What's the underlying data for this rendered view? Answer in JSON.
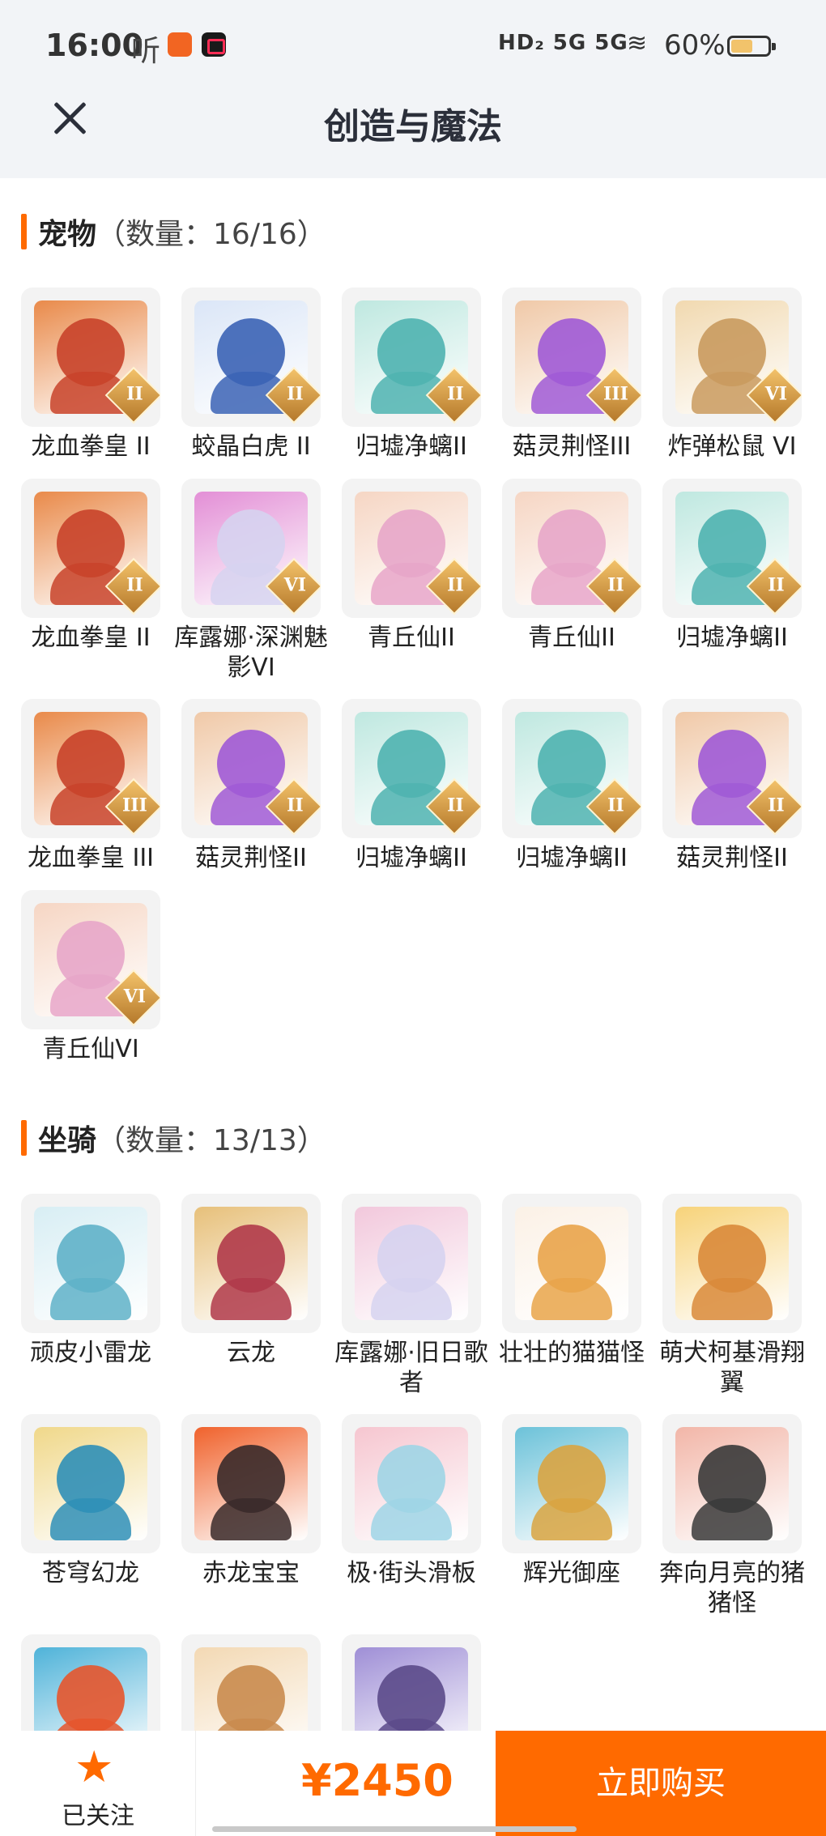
{
  "status_bar": {
    "time": "16:00",
    "listen": "听",
    "network": "HD₂ 5G 5G",
    "battery_text": "60%",
    "battery_level": 0.6
  },
  "header": {
    "title": "创造与魔法",
    "close_icon": "close-icon"
  },
  "pets": {
    "name": "宠物",
    "count": "（数量：16/16）",
    "items": [
      {
        "label": "龙血拳皇 II",
        "badge": "II",
        "color": "#c8432a",
        "accent": "#e98a4a"
      },
      {
        "label": "蛟晶白虎 II",
        "badge": "II",
        "color": "#3b63b5",
        "accent": "#dbe6f7"
      },
      {
        "label": "归墟净螭II",
        "badge": "II",
        "color": "#4fb3b0",
        "accent": "#bfe8e0"
      },
      {
        "label": "菇灵荆怪III",
        "badge": "III",
        "color": "#a05ad6",
        "accent": "#f0c9a8"
      },
      {
        "label": "炸弹松鼠 VI",
        "badge": "VI",
        "color": "#c99a5e",
        "accent": "#f1d9b0"
      },
      {
        "label": "龙血拳皇 II",
        "badge": "II",
        "color": "#c8432a",
        "accent": "#e98a4a"
      },
      {
        "label": "库露娜·深渊魅影VI",
        "badge": "VI",
        "color": "#d6d3f0",
        "accent": "#e38fd6"
      },
      {
        "label": "青丘仙II",
        "badge": "II",
        "color": "#e7a6c9",
        "accent": "#f6d6c4"
      },
      {
        "label": "青丘仙II",
        "badge": "II",
        "color": "#e7a6c9",
        "accent": "#f6d6c4"
      },
      {
        "label": "归墟净螭II",
        "badge": "II",
        "color": "#4fb3b0",
        "accent": "#bfe8e0"
      },
      {
        "label": "龙血拳皇 III",
        "badge": "III",
        "color": "#c8432a",
        "accent": "#e98a4a"
      },
      {
        "label": "菇灵荆怪II",
        "badge": "II",
        "color": "#a05ad6",
        "accent": "#f0c9a8"
      },
      {
        "label": "归墟净螭II",
        "badge": "II",
        "color": "#4fb3b0",
        "accent": "#bfe8e0"
      },
      {
        "label": "归墟净螭II",
        "badge": "II",
        "color": "#4fb3b0",
        "accent": "#bfe8e0"
      },
      {
        "label": "菇灵荆怪II",
        "badge": "II",
        "color": "#a05ad6",
        "accent": "#f0c9a8"
      },
      {
        "label": "青丘仙VI",
        "badge": "VI",
        "color": "#e7a6c9",
        "accent": "#f6d6c4"
      }
    ]
  },
  "mounts": {
    "name": "坐骑",
    "count": "（数量：13/13）",
    "items": [
      {
        "label": "顽皮小雷龙",
        "color": "#5fb1c8",
        "accent": "#d8eef4"
      },
      {
        "label": "云龙",
        "color": "#b03a4a",
        "accent": "#e7c07a"
      },
      {
        "label": "库露娜·旧日歌者",
        "color": "#d6d3f0",
        "accent": "#f2c8dc"
      },
      {
        "label": "壮壮的猫猫怪",
        "color": "#e9a44a",
        "accent": "#fbf1e6"
      },
      {
        "label": "萌犬柯基滑翔翼",
        "color": "#d98a3a",
        "accent": "#f7d37a"
      },
      {
        "label": "苍穹幻龙",
        "color": "#2f8fb7",
        "accent": "#f0d88a"
      },
      {
        "label": "赤龙宝宝",
        "color": "#3a2a2a",
        "accent": "#f0622c"
      },
      {
        "label": "极·街头滑板",
        "color": "#9fd5e6",
        "accent": "#f6c6d0"
      },
      {
        "label": "辉光御座",
        "color": "#d9a441",
        "accent": "#6cc2d9"
      },
      {
        "label": "奔向月亮的猪猪怪",
        "color": "#3a3a3a",
        "accent": "#f2b6a8"
      },
      {
        "label": "",
        "color": "#e6552c",
        "accent": "#4fb3d9"
      },
      {
        "label": "",
        "color": "#c98b4e",
        "accent": "#f3d9b4"
      },
      {
        "label": "",
        "color": "#5b4a8a",
        "accent": "#9f8fd6"
      }
    ]
  },
  "bottom_bar": {
    "follow_label": "已关注",
    "follow_icon": "star-icon",
    "price": "¥2450",
    "buy_label": "立即购买",
    "accent_color": "#ff6a00"
  }
}
